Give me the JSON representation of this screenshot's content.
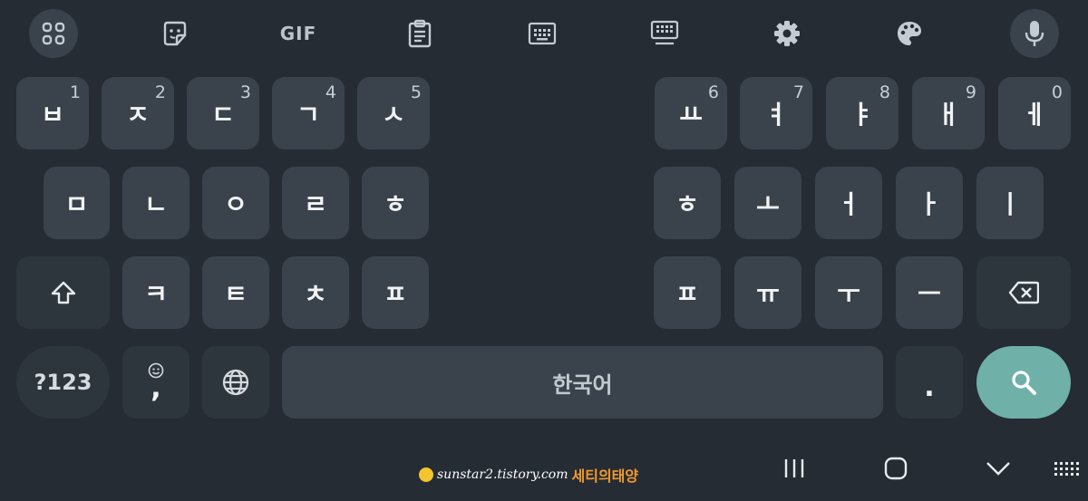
{
  "toolbar": {
    "gif_label": "GIF",
    "icons": [
      "apps-grid-icon",
      "sticker-icon",
      "gif-icon",
      "clipboard-icon",
      "keyboard-icon",
      "one-handed-keyboard-icon",
      "settings-gear-icon",
      "palette-icon",
      "microphone-icon"
    ]
  },
  "rows": {
    "row1_left": [
      {
        "label": "ㅂ",
        "hint": "1"
      },
      {
        "label": "ㅈ",
        "hint": "2"
      },
      {
        "label": "ㄷ",
        "hint": "3"
      },
      {
        "label": "ㄱ",
        "hint": "4"
      },
      {
        "label": "ㅅ",
        "hint": "5"
      }
    ],
    "row1_right": [
      {
        "label": "ㅛ",
        "hint": "6"
      },
      {
        "label": "ㅕ",
        "hint": "7"
      },
      {
        "label": "ㅑ",
        "hint": "8"
      },
      {
        "label": "ㅐ",
        "hint": "9"
      },
      {
        "label": "ㅔ",
        "hint": "0"
      }
    ],
    "row2_left": [
      "ㅁ",
      "ㄴ",
      "ㅇ",
      "ㄹ",
      "ㅎ"
    ],
    "row2_right": [
      "ㅎ",
      "ㅗ",
      "ㅓ",
      "ㅏ",
      "ㅣ"
    ],
    "row3_left": [
      "ㅋ",
      "ㅌ",
      "ㅊ",
      "ㅍ"
    ],
    "row3_right": [
      "ㅍ",
      "ㅠ",
      "ㅜ",
      "ㅡ"
    ]
  },
  "bottom_row": {
    "symbols_label": "?123",
    "emoji_comma": ",",
    "space_label": "한국어",
    "period_label": "."
  },
  "nav": {
    "icons": [
      "recent-apps-icon",
      "home-icon",
      "hide-keyboard-icon",
      "keyboard-switch-icon"
    ]
  },
  "watermark": {
    "url": "sunstar2.tistory.com",
    "name": "세티의태양"
  },
  "colors": {
    "background": "#252c33",
    "key": "#3a434b",
    "key_dark": "#2e363d",
    "accent": "#6fb0a8"
  }
}
